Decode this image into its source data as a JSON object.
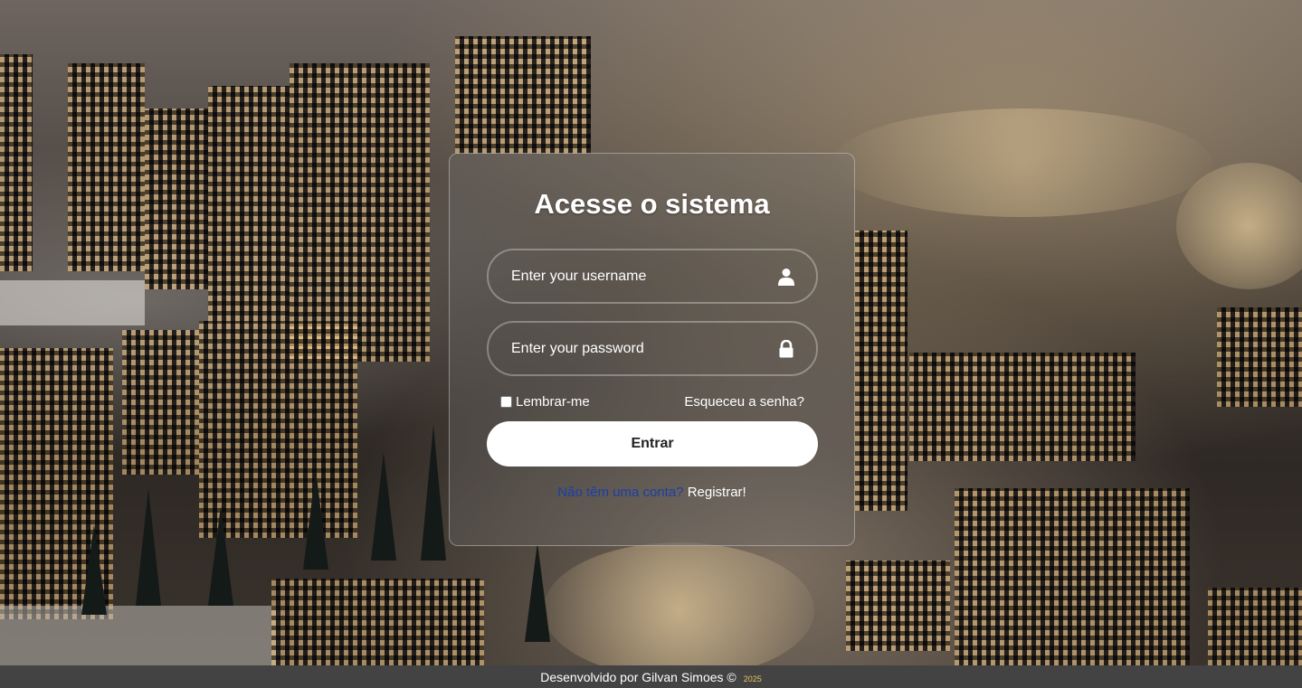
{
  "login": {
    "title": "Acesse o sistema",
    "username_placeholder": "Enter your username",
    "password_placeholder": "Enter your password",
    "remember_label": "Lembrar-me",
    "forgot_label": "Esqueceu a senha?",
    "submit_label": "Entrar",
    "register_question": "Não têm uma conta?",
    "register_link": "Registrar!"
  },
  "icons": {
    "username": "user-icon",
    "password": "lock-icon"
  },
  "footer": {
    "text": "Desenvolvido por Gilvan Simoes ©",
    "year": "2025"
  },
  "colors": {
    "button_bg": "#ffffff",
    "footer_bg": "#434343",
    "register_question": "#1a3fa8",
    "year": "#e8c45a"
  }
}
